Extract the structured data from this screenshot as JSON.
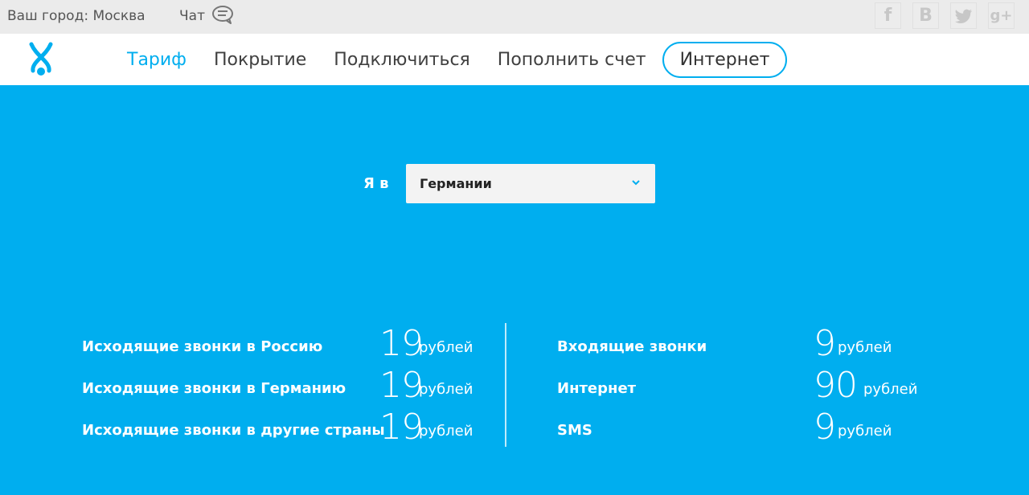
{
  "topbar": {
    "city": "Ваш город: Москва",
    "chat": "Чат",
    "socials": [
      "f",
      "B",
      "twitter",
      "g+"
    ]
  },
  "nav": {
    "items": [
      "Тариф",
      "Покрытие",
      "Подключиться",
      "Пополнить счет",
      "Интернет"
    ]
  },
  "selector": {
    "label": "Я в",
    "value": "Германии"
  },
  "rates_left": [
    {
      "label": "Исходящие звонки в Россию",
      "amount": "19",
      "unit": "рублей"
    },
    {
      "label": "Исходящие звонки в Германию",
      "amount": "19",
      "unit": "рублей"
    },
    {
      "label": "Исходящие звонки в другие страны",
      "amount": "19",
      "unit": "рублей"
    }
  ],
  "rates_right": [
    {
      "label": "Входящие звонки",
      "amount": "9",
      "unit": "рублей"
    },
    {
      "label": "Интернет",
      "amount": "90",
      "unit": "рублей"
    },
    {
      "label": "SMS",
      "amount": "9",
      "unit": "рублей"
    }
  ],
  "colors": {
    "brand": "#00aeef",
    "topbar": "#ebebeb",
    "nav_text": "#404040"
  }
}
